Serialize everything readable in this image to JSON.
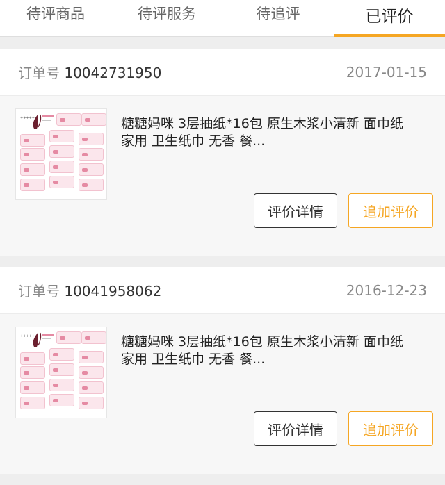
{
  "tabs": [
    {
      "label": "待评商品"
    },
    {
      "label": "待评服务"
    },
    {
      "label": "待追评"
    },
    {
      "label": "已评价"
    }
  ],
  "active_tab": "已评价",
  "accent_color": "#f5a623",
  "orders": [
    {
      "order_label": "订单号",
      "order_number": "10042731950",
      "date": "2017-01-15",
      "product_title_line1": "糖糖妈咪 3层抽纸*16包 原生木浆小清新 面巾纸",
      "product_title_line2": "家用 卫生纸巾 无香 餐...",
      "detail_button": "评价详情",
      "append_button": "追加评价"
    },
    {
      "order_label": "订单号",
      "order_number": "10041958062",
      "date": "2016-12-23",
      "product_title_line1": "糖糖妈咪 3层抽纸*16包 原生木浆小清新 面巾纸",
      "product_title_line2": "家用 卫生纸巾 无香 餐...",
      "detail_button": "评价详情",
      "append_button": "追加评价"
    }
  ],
  "icons": {
    "product_thumbnail": "tissue-pack-thumbnail",
    "brand_logo": "brand-logo"
  }
}
